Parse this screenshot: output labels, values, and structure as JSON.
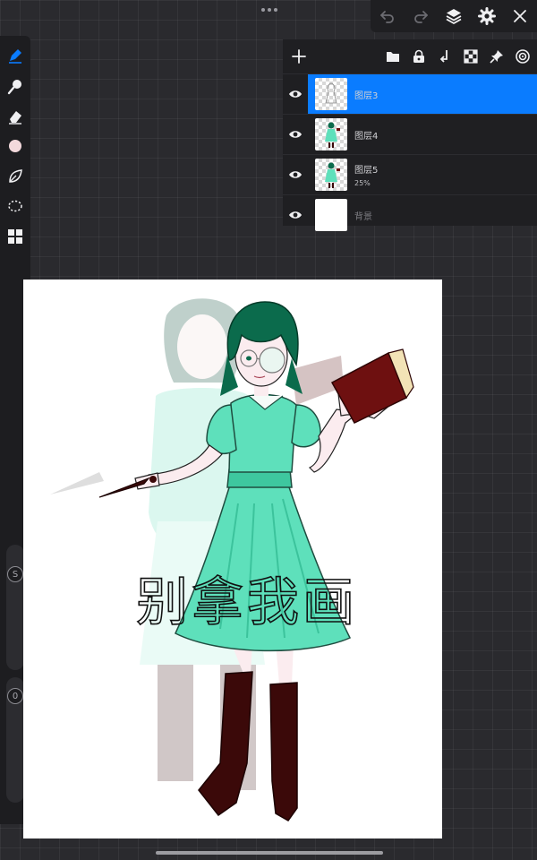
{
  "top_bar": {
    "undo_icon": "undo-icon",
    "redo_icon": "redo-icon",
    "layers_icon": "layers-icon",
    "settings_icon": "gear-icon",
    "close_icon": "close-icon"
  },
  "left_toolbar": {
    "tools": [
      "brush-pen-icon",
      "smudge-icon",
      "eraser-icon",
      "color-swatch",
      "leaf-icon",
      "lasso-select-icon",
      "transform-grid-icon"
    ],
    "color_swatch": "#f3d9dc",
    "accent": "#0a7cff",
    "brush_size_label": "S",
    "opacity_label": "0"
  },
  "layers_panel": {
    "add_label": "+",
    "toolbar_icons": [
      "folder-icon",
      "lock-icon",
      "merge-down-icon",
      "checkerboard-icon",
      "pin-icon",
      "reference-icon"
    ],
    "layers": [
      {
        "name": "图层3",
        "sub": "",
        "active": true
      },
      {
        "name": "图层4",
        "sub": "",
        "active": false
      },
      {
        "name": "图层5",
        "sub": "25%",
        "active": false
      },
      {
        "name": "背景",
        "sub": "",
        "active": false
      }
    ]
  },
  "canvas": {
    "handwritten_text": "别拿我画",
    "dress_color": "#5ee0bb",
    "hair_color": "#0b6b4c",
    "boot_color": "#3b0909",
    "book_color": "#6e1010"
  }
}
